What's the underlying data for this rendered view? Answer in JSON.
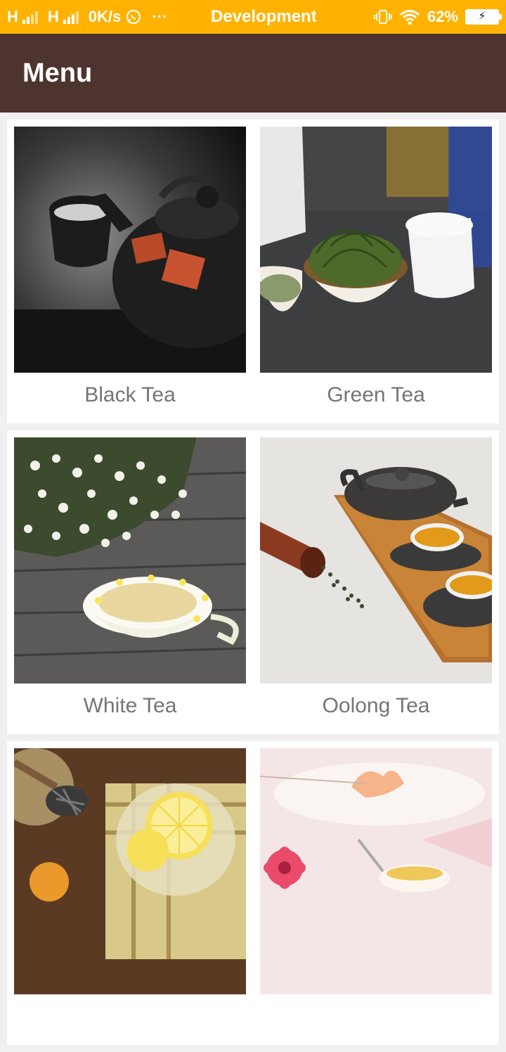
{
  "status_bar": {
    "net1": "H",
    "net2": "H",
    "speed": "0K/s",
    "more": "···",
    "app_name": "Development",
    "battery_percent": "62%",
    "icons": [
      "signal-icon",
      "whatsapp-icon",
      "vibrate-icon",
      "wifi-icon",
      "battery-icon"
    ]
  },
  "app_bar": {
    "title": "Menu"
  },
  "menu": {
    "items": [
      {
        "label": "Black Tea"
      },
      {
        "label": "Green Tea"
      },
      {
        "label": "White Tea"
      },
      {
        "label": "Oolong Tea"
      },
      {
        "label": ""
      },
      {
        "label": ""
      }
    ]
  },
  "colors": {
    "status_bar": "#ffb300",
    "app_bar": "#4e342e",
    "label_text": "#757575",
    "background": "#f0f0f0"
  }
}
